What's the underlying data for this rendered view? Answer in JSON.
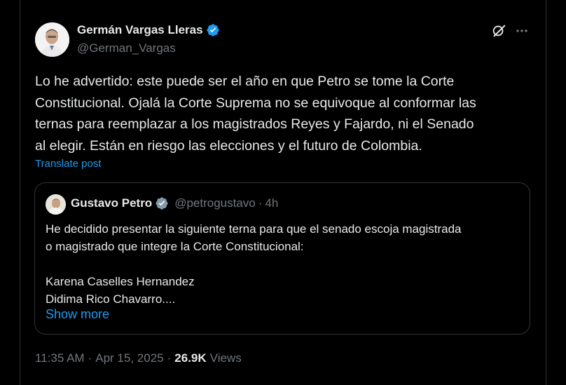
{
  "post": {
    "author_name": "Germán Vargas Lleras",
    "author_handle": "@German_Vargas",
    "text": "Lo he advertido: este puede ser el año en que Petro se tome la Corte\nConstitucional. Ojalá la Corte Suprema no se equivoque al conformar las\nternas para reemplazar a los magistrados Reyes y Fajardo, ni el Senado\nal elegir. Están en riesgo las elecciones y el futuro de Colombia.",
    "translate_label": "Translate post",
    "time": "11:35 AM",
    "date": "Apr 15, 2025",
    "views_count": "26.9K",
    "views_label": "Views",
    "separator": "·"
  },
  "quote": {
    "author_name": "Gustavo Petro",
    "author_handle": "@petrogustavo",
    "separator": "·",
    "time": "4h",
    "text": "He decidido presentar la siguiente terna para que el senado escoja magistrada\no magistrado que integre la Corte Constitucional:\n\nKarena Caselles Hernandez\nDidima Rico Chavarro....",
    "show_more_label": "Show more"
  },
  "icons": {
    "verified": "verified-badge-icon",
    "grok": "grok-icon",
    "more": "more-icon"
  },
  "colors": {
    "background": "#000000",
    "text": "#e7e9ea",
    "secondary": "#71767b",
    "accent": "#1d9bf0",
    "border": "#2f3336"
  }
}
